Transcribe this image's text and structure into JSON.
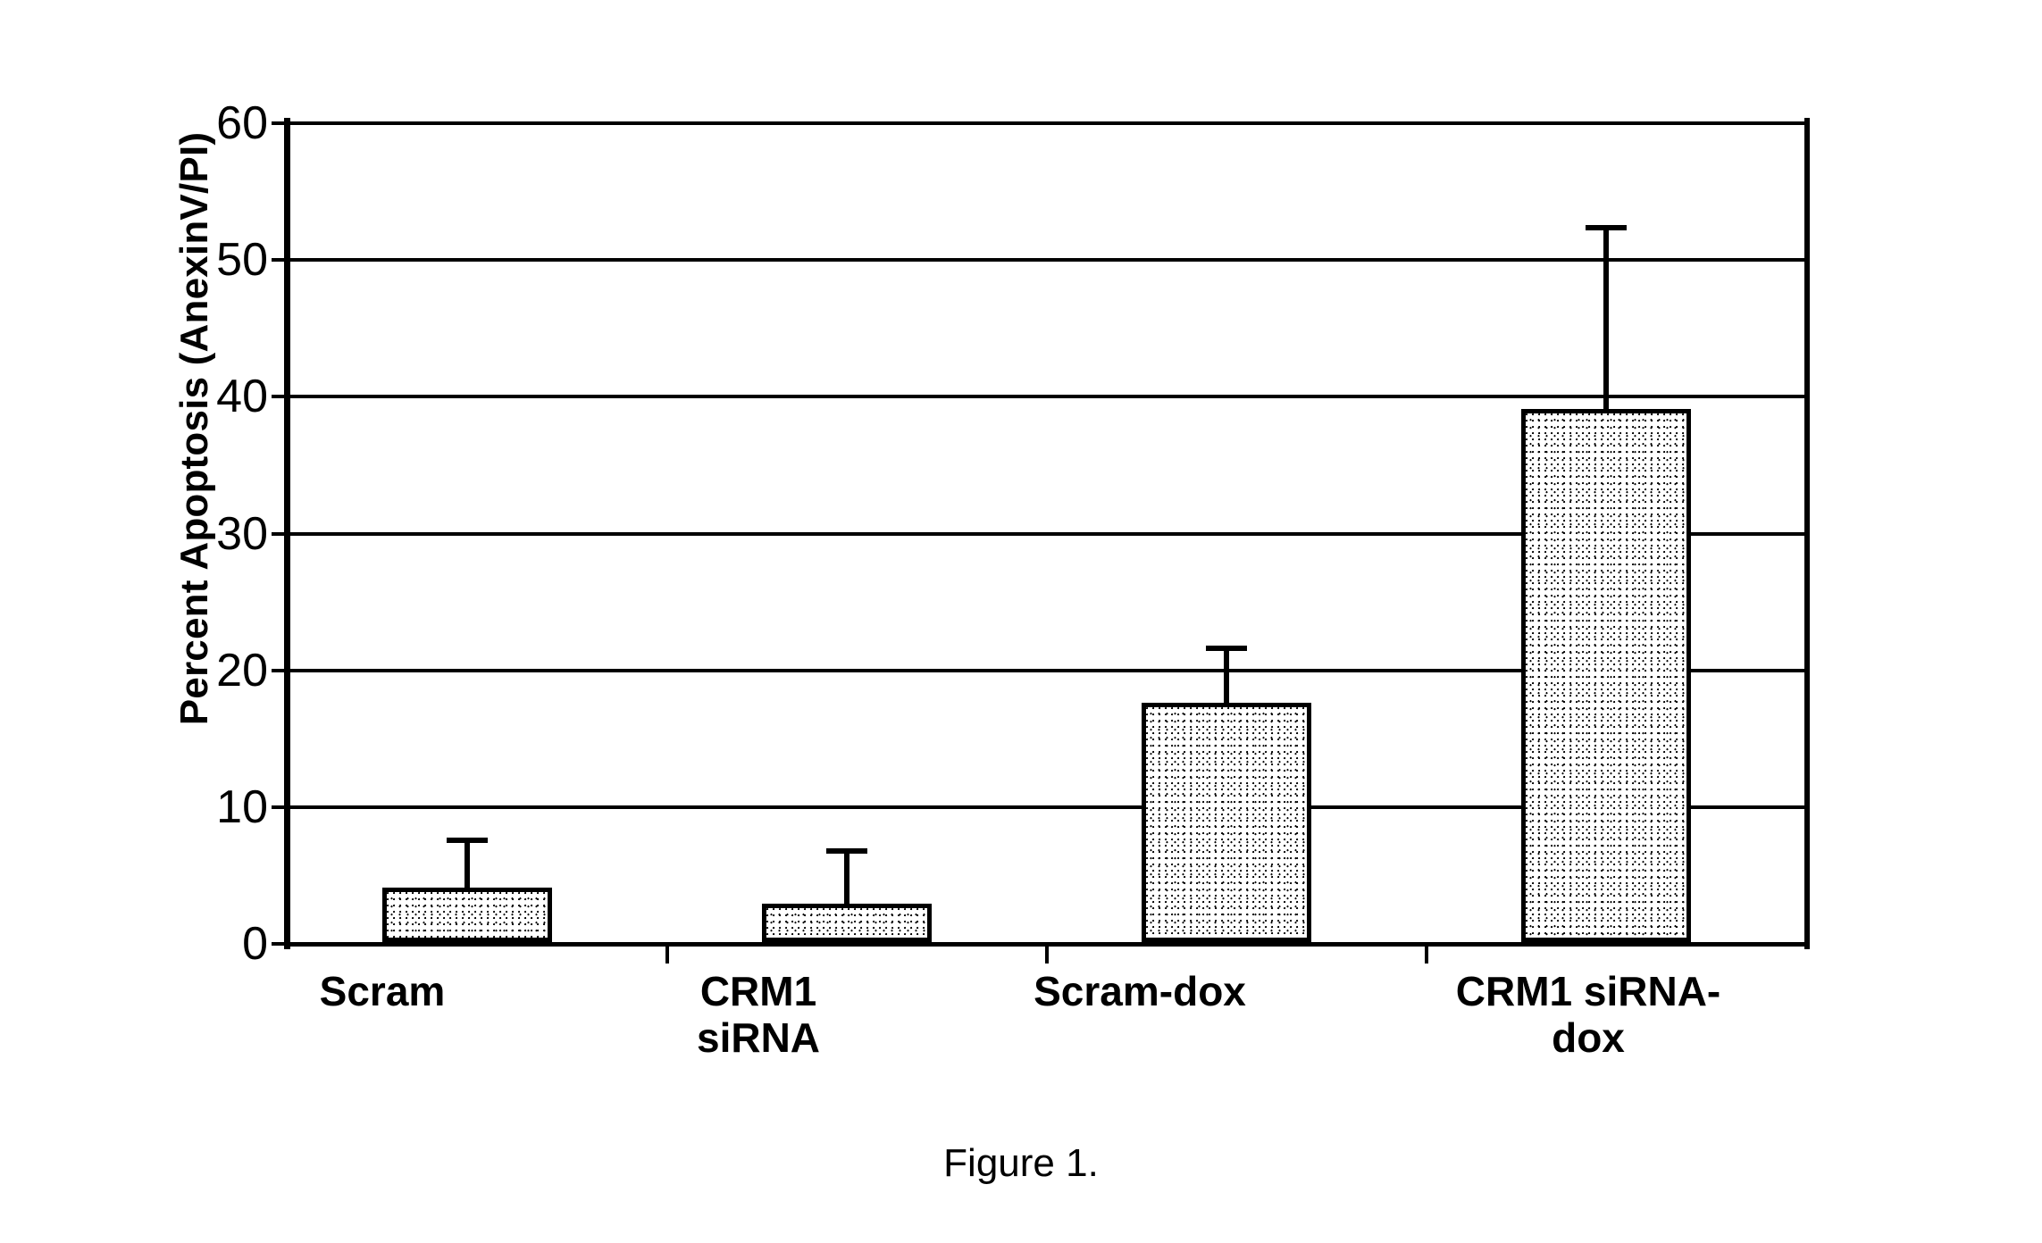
{
  "chart_data": {
    "type": "bar",
    "title": "",
    "xlabel": "",
    "ylabel": "Percent Apoptosis (AnexinV/PI)",
    "categories": [
      "Scram",
      "CRM1 siRNA",
      "Scram-dox",
      "CRM1 siRNA-dox"
    ],
    "values": [
      4.0,
      2.8,
      17.5,
      39.0
    ],
    "error_upper": [
      7.5,
      6.8,
      21.5,
      52.2
    ],
    "error_bars": "upper only (standard deviation)",
    "ylim": [
      0,
      60
    ],
    "yticks": [
      0,
      10,
      20,
      30,
      40,
      50,
      60
    ],
    "ytick_labels": [
      "0",
      "10",
      "20",
      "30",
      "40",
      "50",
      "60"
    ],
    "grid": "horizontal gridlines at every major y tick",
    "legend": "none",
    "bar_fill": "#ffffff stipple pattern (light gray appearance)",
    "bar_border_color": "#000000",
    "series": [
      {
        "name": "Percent Apoptosis",
        "values": [
          4.0,
          2.8,
          17.5,
          39.0
        ]
      }
    ]
  },
  "caption": {
    "text": "Figure 1."
  },
  "axis": {
    "y_title": "Percent Apoptosis (AnexinV/PI)",
    "y_tick_labels": [
      "60",
      "50",
      "40",
      "30",
      "20",
      "10",
      "0"
    ],
    "x_tick_labels": [
      "Scram",
      "CRM1 siRNA",
      "Scram-dox",
      "CRM1 siRNA-\ndox"
    ]
  },
  "colors": {
    "ink": "#000000",
    "background": "#ffffff",
    "bar_fill": "#e8e8e8"
  }
}
